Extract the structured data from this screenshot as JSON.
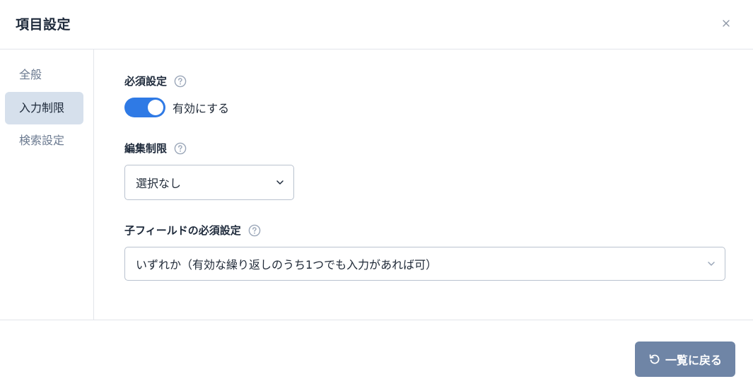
{
  "dialog": {
    "title": "項目設定"
  },
  "sidebar": {
    "items": [
      {
        "label": "全般"
      },
      {
        "label": "入力制限"
      },
      {
        "label": "検索設定"
      }
    ]
  },
  "required": {
    "label": "必須設定",
    "toggle_label": "有効にする",
    "enabled": true
  },
  "edit_restriction": {
    "label": "編集制限",
    "selected": "選択なし"
  },
  "child_required": {
    "label": "子フィールドの必須設定",
    "selected": "いずれか（有効な繰り返しのうち1つでも入力があれば可）"
  },
  "footer": {
    "back_label": "一覧に戻る"
  },
  "colors": {
    "accent": "#2f7ae5",
    "active_nav": "#d6e0ec",
    "button": "#6f85a6"
  }
}
